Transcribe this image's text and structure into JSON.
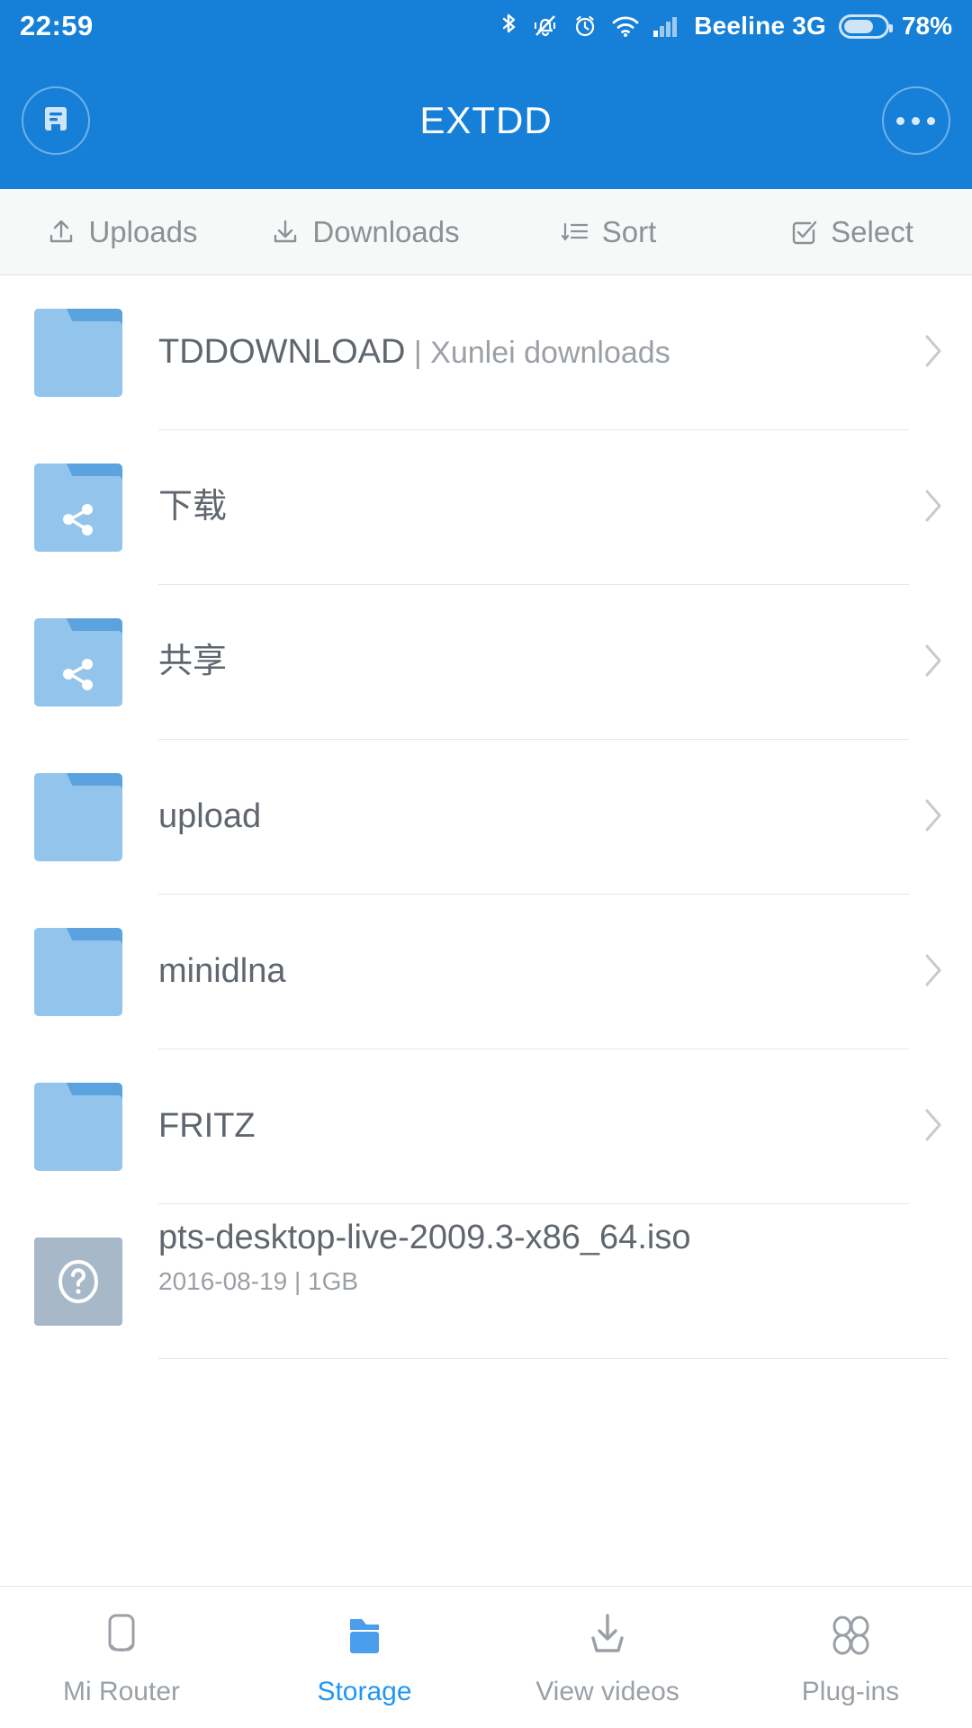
{
  "status_bar": {
    "time": "22:59",
    "icons": [
      "bluetooth-icon",
      "silent-bell-icon",
      "alarm-icon",
      "wifi-icon",
      "cellular-signal-icon"
    ],
    "carrier": "Beeline 3G",
    "battery_percent": "78%"
  },
  "header": {
    "title": "EXTDD",
    "left_icon": "device-storage-icon",
    "right_icon": "more-options-icon"
  },
  "toolbar": {
    "items": [
      {
        "label": "Uploads",
        "icon": "upload-icon"
      },
      {
        "label": "Downloads",
        "icon": "download-icon"
      },
      {
        "label": "Sort",
        "icon": "sort-icon"
      },
      {
        "label": "Select",
        "icon": "checkbox-check-icon"
      }
    ]
  },
  "file_list": [
    {
      "name": "TDDOWNLOAD",
      "subtitle": " | Xunlei downloads",
      "icon": "folder-icon",
      "type": "folder",
      "chevron": true
    },
    {
      "name": "下载",
      "subtitle": "",
      "icon": "shared-folder-icon",
      "type": "shared-folder",
      "chevron": true
    },
    {
      "name": "共享",
      "subtitle": "",
      "icon": "shared-folder-icon",
      "type": "shared-folder",
      "chevron": true
    },
    {
      "name": "upload",
      "subtitle": "",
      "icon": "folder-icon",
      "type": "folder",
      "chevron": true
    },
    {
      "name": "minidlna",
      "subtitle": "",
      "icon": "folder-icon",
      "type": "folder",
      "chevron": true
    },
    {
      "name": "FRITZ",
      "subtitle": "",
      "icon": "folder-icon",
      "type": "folder",
      "chevron": true
    },
    {
      "name": "pts-desktop-live-2009.3-x86_64.iso",
      "subtitle": "",
      "meta": "2016-08-19 | 1GB",
      "icon": "unknown-file-icon",
      "type": "file",
      "chevron": false
    }
  ],
  "bottom_nav": {
    "items": [
      {
        "label": "Mi Router",
        "icon": "router-icon",
        "active": false
      },
      {
        "label": "Storage",
        "icon": "folder-solid-icon",
        "active": true
      },
      {
        "label": "View videos",
        "icon": "download-tray-icon",
        "active": false
      },
      {
        "label": "Plug-ins",
        "icon": "plugins-grid-icon",
        "active": false
      }
    ]
  },
  "colors": {
    "brand_blue": "#1680d8",
    "accent_blue": "#2196f3",
    "folder_blue": "#93c5ec",
    "folder_tab_blue": "#5ba3de",
    "text_gray": "#5f666d",
    "muted_gray": "#9aa0a6"
  }
}
